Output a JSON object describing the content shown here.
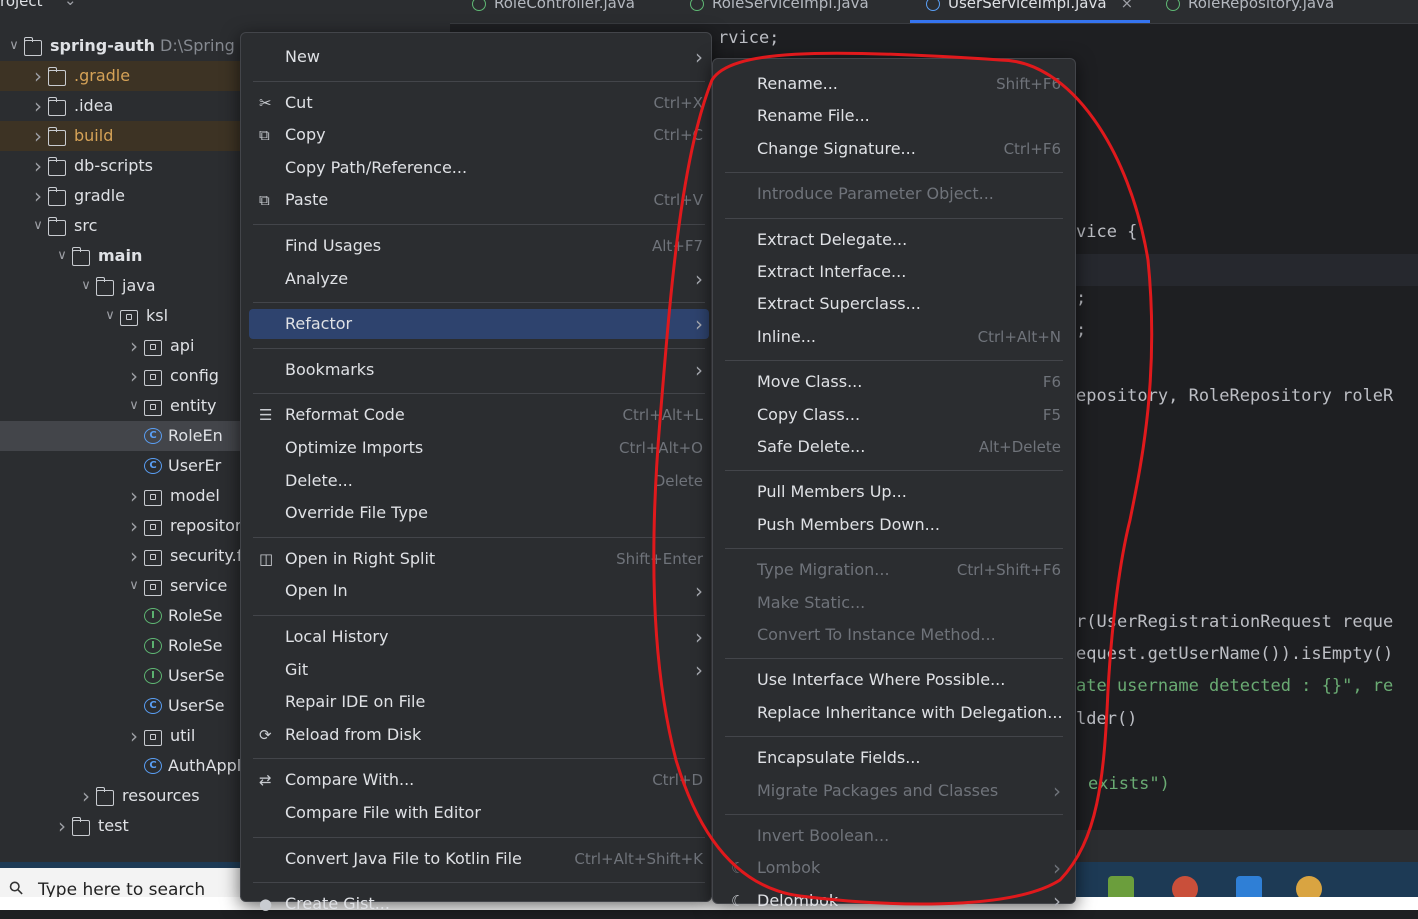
{
  "project_panel": {
    "header": "roject",
    "tree": [
      {
        "label": "spring-auth",
        "extra": "D:\\Spring P",
        "depth": 0,
        "chev": "v",
        "icon": "module",
        "bold": true
      },
      {
        "label": ".gradle",
        "depth": 1,
        "chev": ">",
        "icon": "folder",
        "excluded": true
      },
      {
        "label": ".idea",
        "depth": 1,
        "chev": ">",
        "icon": "folder"
      },
      {
        "label": "build",
        "depth": 1,
        "chev": ">",
        "icon": "folder",
        "excluded": true
      },
      {
        "label": "db-scripts",
        "depth": 1,
        "chev": ">",
        "icon": "folder"
      },
      {
        "label": "gradle",
        "depth": 1,
        "chev": ">",
        "icon": "folder"
      },
      {
        "label": "src",
        "depth": 1,
        "chev": "v",
        "icon": "folder"
      },
      {
        "label": "main",
        "depth": 2,
        "chev": "v",
        "icon": "folder",
        "bold": true
      },
      {
        "label": "java",
        "depth": 3,
        "chev": "v",
        "icon": "folder"
      },
      {
        "label": "ksl",
        "depth": 4,
        "chev": "v",
        "icon": "package"
      },
      {
        "label": "api",
        "depth": 5,
        "chev": ">",
        "icon": "package"
      },
      {
        "label": "config",
        "depth": 5,
        "chev": ">",
        "icon": "package"
      },
      {
        "label": "entity",
        "depth": 5,
        "chev": "v",
        "icon": "package"
      },
      {
        "label": "RoleEn",
        "depth": 6,
        "chev": "",
        "icon": "class",
        "selected": true
      },
      {
        "label": "UserEr",
        "depth": 6,
        "chev": "",
        "icon": "class"
      },
      {
        "label": "model",
        "depth": 5,
        "chev": ">",
        "icon": "package"
      },
      {
        "label": "repository",
        "depth": 5,
        "chev": ">",
        "icon": "package"
      },
      {
        "label": "security.fi",
        "depth": 5,
        "chev": ">",
        "icon": "package"
      },
      {
        "label": "service",
        "depth": 5,
        "chev": "v",
        "icon": "package"
      },
      {
        "label": "RoleSe",
        "depth": 6,
        "chev": "",
        "icon": "interface"
      },
      {
        "label": "RoleSe",
        "depth": 6,
        "chev": "",
        "icon": "interface"
      },
      {
        "label": "UserSe",
        "depth": 6,
        "chev": "",
        "icon": "interface"
      },
      {
        "label": "UserSe",
        "depth": 6,
        "chev": "",
        "icon": "class"
      },
      {
        "label": "util",
        "depth": 5,
        "chev": ">",
        "icon": "package"
      },
      {
        "label": "AuthAppli",
        "depth": 6,
        "chev": "",
        "icon": "class"
      },
      {
        "label": "resources",
        "depth": 3,
        "chev": ">",
        "icon": "folder"
      },
      {
        "label": "test",
        "depth": 2,
        "chev": ">",
        "icon": "folder"
      }
    ]
  },
  "editor": {
    "tabs": [
      "RoleController.java",
      "RoleServiceImpl.java",
      "UserServiceImpl.java",
      "RoleRepository.java"
    ],
    "tab_close": "×",
    "lines": [
      {
        "text": "rvice;",
        "color": "#bcbec4"
      },
      {
        "text": "vice {",
        "color": "#bcbec4"
      },
      {
        "text": ";",
        "color": "#bcbec4"
      },
      {
        "text": ";",
        "color": "#bcbec4"
      },
      {
        "text": "epository, RoleRepository roleR",
        "color": "#bcbec4"
      },
      {
        "text": "r(UserRegistrationRequest reque",
        "color": "#bcbec4"
      },
      {
        "text": "equest.getUserName()).isEmpty()",
        "color": "#bcbec4"
      },
      {
        "text": "ate username detected : {}\", re",
        "color": "#6aab73"
      },
      {
        "text": "lder()",
        "color": "#bcbec4"
      },
      {
        "text": "exists\")",
        "color": "#6aab73"
      }
    ]
  },
  "context_menu": {
    "items": [
      {
        "label": "New",
        "submenu": true
      },
      {
        "sep": true
      },
      {
        "label": "Cut",
        "shortcut": "Ctrl+X",
        "icon": "cut-icon",
        "glyph": "✂"
      },
      {
        "label": "Copy",
        "shortcut": "Ctrl+C",
        "icon": "copy-icon",
        "glyph": "⧉"
      },
      {
        "label": "Copy Path/Reference..."
      },
      {
        "label": "Paste",
        "shortcut": "Ctrl+V",
        "icon": "paste-icon",
        "glyph": "⧉"
      },
      {
        "sep": true
      },
      {
        "label": "Find Usages",
        "shortcut": "Alt+F7"
      },
      {
        "label": "Analyze",
        "submenu": true
      },
      {
        "sep": true
      },
      {
        "label": "Refactor",
        "submenu": true,
        "selected": true
      },
      {
        "sep": true
      },
      {
        "label": "Bookmarks",
        "submenu": true
      },
      {
        "sep": true
      },
      {
        "label": "Reformat Code",
        "shortcut": "Ctrl+Alt+L",
        "icon": "reformat-icon",
        "glyph": "☰"
      },
      {
        "label": "Optimize Imports",
        "shortcut": "Ctrl+Alt+O"
      },
      {
        "label": "Delete...",
        "shortcut": "Delete"
      },
      {
        "label": "Override File Type"
      },
      {
        "sep": true
      },
      {
        "label": "Open in Right Split",
        "shortcut": "Shift+Enter",
        "icon": "split-icon",
        "glyph": "◫"
      },
      {
        "label": "Open In",
        "submenu": true
      },
      {
        "sep": true
      },
      {
        "label": "Local History",
        "submenu": true
      },
      {
        "label": "Git",
        "submenu": true
      },
      {
        "label": "Repair IDE on File"
      },
      {
        "label": "Reload from Disk",
        "icon": "reload-icon",
        "glyph": "⟳"
      },
      {
        "sep": true
      },
      {
        "label": "Compare With...",
        "shortcut": "Ctrl+D",
        "icon": "compare-icon",
        "glyph": "⇄"
      },
      {
        "label": "Compare File with Editor"
      },
      {
        "sep": true
      },
      {
        "label": "Convert Java File to Kotlin File",
        "shortcut": "Ctrl+Alt+Shift+K"
      },
      {
        "sep": true
      },
      {
        "label": "Create Gist...",
        "icon": "github-icon",
        "glyph": "●"
      }
    ]
  },
  "refactor_submenu": {
    "items": [
      {
        "label": "Rename...",
        "shortcut": "Shift+F6"
      },
      {
        "label": "Rename File..."
      },
      {
        "label": "Change Signature...",
        "shortcut": "Ctrl+F6"
      },
      {
        "sep": true
      },
      {
        "label": "Introduce Parameter Object...",
        "disabled": true
      },
      {
        "sep": true
      },
      {
        "label": "Extract Delegate..."
      },
      {
        "label": "Extract Interface..."
      },
      {
        "label": "Extract Superclass..."
      },
      {
        "label": "Inline...",
        "shortcut": "Ctrl+Alt+N"
      },
      {
        "sep": true
      },
      {
        "label": "Move Class...",
        "shortcut": "F6"
      },
      {
        "label": "Copy Class...",
        "shortcut": "F5"
      },
      {
        "label": "Safe Delete...",
        "shortcut": "Alt+Delete"
      },
      {
        "sep": true
      },
      {
        "label": "Pull Members Up..."
      },
      {
        "label": "Push Members Down..."
      },
      {
        "sep": true
      },
      {
        "label": "Type Migration...",
        "shortcut": "Ctrl+Shift+F6",
        "disabled": true
      },
      {
        "label": "Make Static...",
        "disabled": true
      },
      {
        "label": "Convert To Instance Method...",
        "disabled": true
      },
      {
        "sep": true
      },
      {
        "label": "Use Interface Where Possible..."
      },
      {
        "label": "Replace Inheritance with Delegation..."
      },
      {
        "sep": true
      },
      {
        "label": "Encapsulate Fields..."
      },
      {
        "label": "Migrate Packages and Classes",
        "submenu": true,
        "disabled": true
      },
      {
        "sep": true
      },
      {
        "label": "Invert Boolean...",
        "disabled": true
      },
      {
        "label": "Lombok",
        "submenu": true,
        "disabled": true,
        "icon": "lombok-icon",
        "glyph": "☾"
      },
      {
        "label": "Delombok",
        "submenu": true,
        "icon": "delombok-icon",
        "glyph": "☾"
      }
    ]
  },
  "taskbar": {
    "search_placeholder": "Type here to search",
    "search_glyph": "⚲"
  },
  "colors": {
    "accent": "#2e436e",
    "annotation": "#e0191c"
  }
}
